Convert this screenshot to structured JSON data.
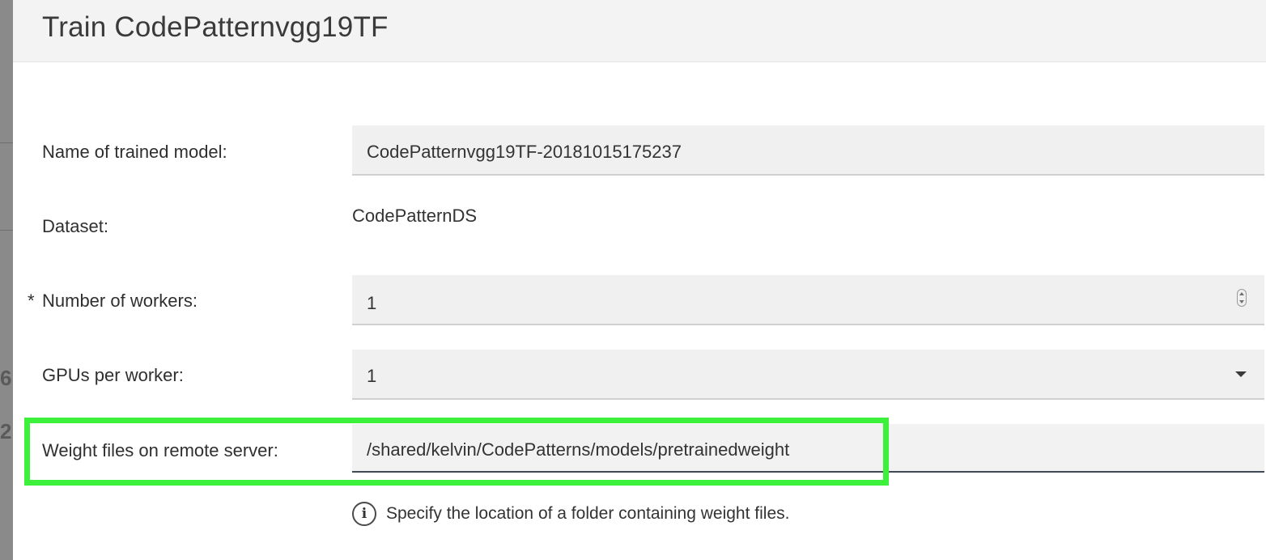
{
  "dialog": {
    "title": "Train CodePatternvgg19TF"
  },
  "form": {
    "model_name": {
      "label": "Name of trained model:",
      "value": "CodePatternvgg19TF-20181015175237"
    },
    "dataset": {
      "label": "Dataset:",
      "value": "CodePatternDS"
    },
    "workers": {
      "required_marker": "*",
      "label": "Number of workers:",
      "value": "1",
      "control_icon": "spinner-updown-icon"
    },
    "gpus": {
      "label": "GPUs per worker:",
      "value": "1",
      "control_icon": "chevron-down-icon"
    },
    "weight_files": {
      "label": "Weight files on remote server:",
      "value": "/shared/kelvin/CodePatterns/models/pretrainedweight",
      "highlight_color": "#3cf03c"
    },
    "help": {
      "icon": "info-icon",
      "text": "Specify the location of a folder containing weight files."
    }
  },
  "background": {
    "partial_glyphs": [
      "6",
      "2"
    ]
  }
}
